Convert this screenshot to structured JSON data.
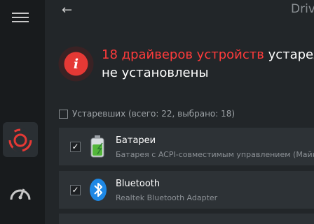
{
  "header": {
    "title": "Driv",
    "back_icon": "back-arrow-icon"
  },
  "sidebar": {
    "items": [
      {
        "name": "menu",
        "icon": "hamburger-icon"
      },
      {
        "name": "drivers",
        "icon": "driver-update-icon",
        "active": true
      },
      {
        "name": "speed",
        "icon": "speedometer-icon"
      }
    ]
  },
  "alert": {
    "icon": "info-alert-icon",
    "highlight": "18 драйверов устройств",
    "text_rest": " устарели",
    "line2": "не установлены"
  },
  "summary": {
    "label": "Устаревших (всего: 22, выбрано: 18)"
  },
  "drivers": [
    {
      "name": "Батареи",
      "description": "Батарея с ACPI-совместимым управлением (Майкр",
      "icon": "battery-icon",
      "checked": true
    },
    {
      "name": "Bluetooth",
      "description": "Realtek Bluetooth Adapter",
      "icon": "bluetooth-icon",
      "checked": true
    }
  ],
  "colors": {
    "accent": "#ff3b3b",
    "sidebar_bg": "#181b1d",
    "main_bg": "#222629",
    "row_bg": "#2d3236"
  }
}
